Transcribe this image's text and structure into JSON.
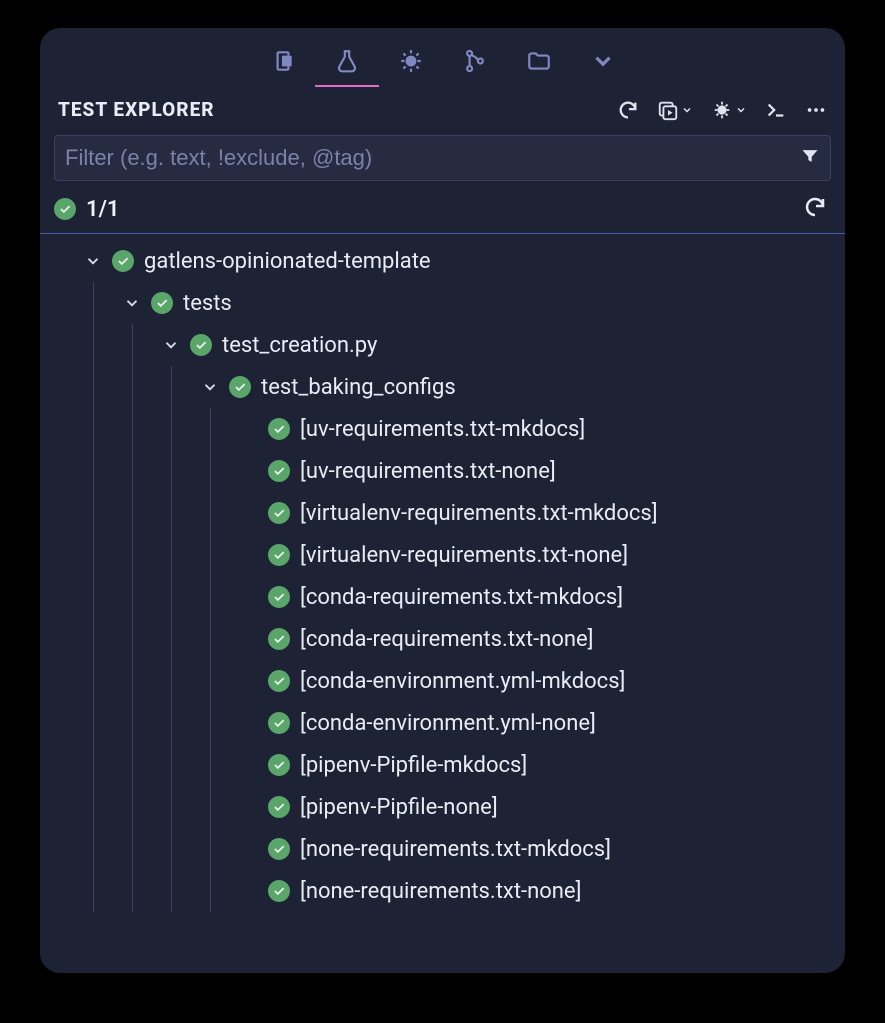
{
  "section_title": "TEST EXPLORER",
  "filter_placeholder": "Filter (e.g. text, !exclude, @tag)",
  "summary_count": "1/1",
  "tree": {
    "root": "gatlens-opinionated-template",
    "child1": "tests",
    "child2": "test_creation.py",
    "child3": "test_baking_configs",
    "leaves": [
      "[uv-requirements.txt-mkdocs]",
      "[uv-requirements.txt-none]",
      "[virtualenv-requirements.txt-mkdocs]",
      "[virtualenv-requirements.txt-none]",
      "[conda-requirements.txt-mkdocs]",
      "[conda-requirements.txt-none]",
      "[conda-environment.yml-mkdocs]",
      "[conda-environment.yml-none]",
      "[pipenv-Pipfile-mkdocs]",
      "[pipenv-Pipfile-none]",
      "[none-requirements.txt-mkdocs]",
      "[none-requirements.txt-none]"
    ]
  },
  "icons": {},
  "colors": {
    "pass": "#5aa66a",
    "accent": "#e06cc3"
  }
}
